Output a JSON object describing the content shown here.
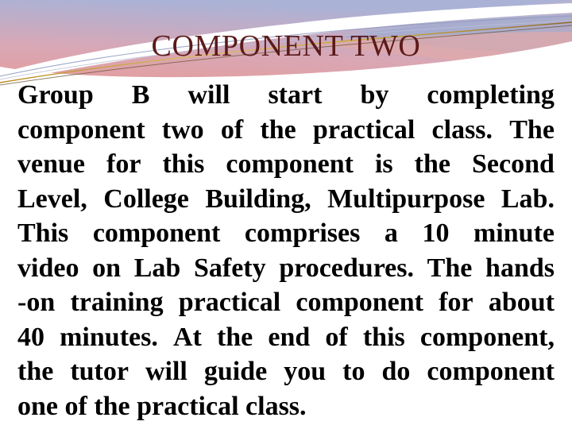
{
  "slide": {
    "title": "COMPONENT TWO",
    "title_color": "#5b1a1a",
    "background_color": "#ffffff",
    "body_text_color": "#000000",
    "body_paragraph": "Group B will start by completing component two of the practical class. The venue for this component is the Second Level, College Building, Multipurpose Lab. This component comprises a 10 minute video on Lab Safety procedures. The hands-on training practical component for about 40 minutes. At the end of this component, the tutor will guide you to do component one of the practical class.",
    "lines": [
      "Group B will start by completing",
      "component two of the practical class. The",
      "venue for this component is the Second",
      "Level, College Building, Multipurpose Lab.",
      "This component comprises a 10 minute",
      "video on Lab Safety procedures. The hands",
      "-on training practical component for about",
      "40 minutes. At the end of this component,",
      "the tutor will guide you to do component",
      "one of the practical class."
    ],
    "line_words": [
      [
        "Group",
        "B",
        "will",
        "start",
        "by",
        "completing"
      ],
      [
        "component",
        "two",
        "of",
        "the",
        "practical",
        "class.",
        "The"
      ],
      [
        "venue",
        "for",
        "this",
        "component",
        "is",
        "the",
        "Second"
      ],
      [
        "Level,",
        "College",
        "Building,",
        "Multipurpose",
        "Lab."
      ],
      [
        "This",
        "component",
        "comprises",
        "a",
        "10",
        "minute"
      ],
      [
        "video",
        "on",
        "Lab",
        "Safety",
        "procedures.",
        "The",
        "hands"
      ],
      [
        "-on",
        "training",
        "practical",
        "component",
        "for",
        "about"
      ],
      [
        "40",
        "minutes.",
        "At",
        "the",
        "end",
        "of",
        "this",
        "component,"
      ],
      [
        "the",
        "tutor",
        "will",
        "guide",
        "you",
        "to",
        "do",
        "component"
      ],
      [
        "one",
        "of",
        "the",
        "practical",
        "class."
      ]
    ],
    "decoration": {
      "name": "swoosh-banner",
      "colors": {
        "pink": "#e8afae",
        "salmon": "#e4a9a5",
        "lavender": "#b6bcd8",
        "periwinkle": "#a7b0d4",
        "blue_gray": "#9aa6cc",
        "pale_blue": "#c8d0e6",
        "gold_line": "#c9a227",
        "dark_line": "#5b4a3a",
        "white": "#ffffff"
      }
    }
  }
}
